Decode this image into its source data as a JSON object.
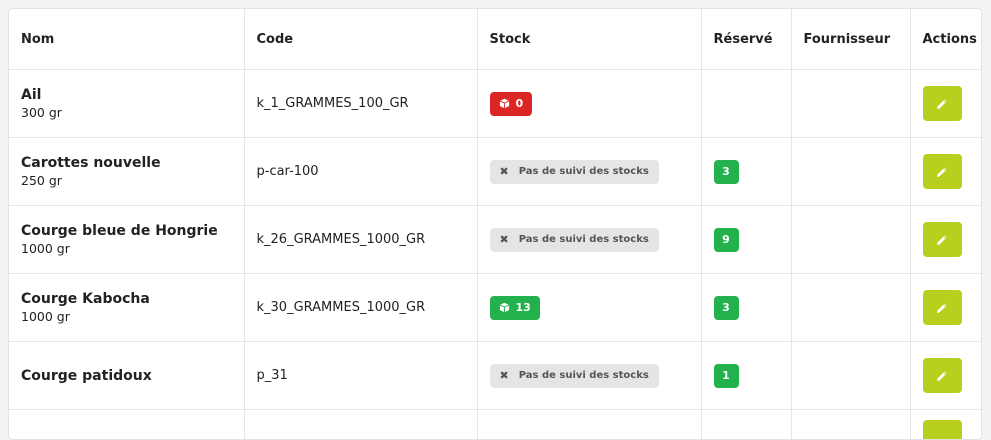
{
  "colors": {
    "danger": "#dc2626",
    "success": "#22b14c",
    "neutral": "#e5e5e5",
    "action": "#b8cf1d"
  },
  "table": {
    "headers": {
      "nom": "Nom",
      "code": "Code",
      "stock": "Stock",
      "reserve": "Réservé",
      "fournisseur": "Fournisseur",
      "actions": "Actions"
    },
    "rows": [
      {
        "name": "Ail",
        "qty": "300 gr",
        "code": "k_1_GRAMMES_100_GR",
        "stock_type": "number",
        "stock_status": "danger",
        "stock": "0",
        "reserve": "",
        "fournisseur": "",
        "stock_icon": "box-icon"
      },
      {
        "name": "Carottes nouvelle",
        "qty": "250 gr",
        "code": "p-car-100",
        "stock_type": "untracked",
        "stock": "Pas de suivi des stocks",
        "reserve": "3",
        "fournisseur": "",
        "stock_icon": "close-icon"
      },
      {
        "name": "Courge bleue de Hongrie",
        "qty": "1000 gr",
        "code": "k_26_GRAMMES_1000_GR",
        "stock_type": "untracked",
        "stock": "Pas de suivi des stocks",
        "reserve": "9",
        "fournisseur": "",
        "stock_icon": "close-icon"
      },
      {
        "name": "Courge Kabocha",
        "qty": "1000 gr",
        "code": "k_30_GRAMMES_1000_GR",
        "stock_type": "number",
        "stock_status": "success",
        "stock": "13",
        "reserve": "3",
        "fournisseur": "",
        "stock_icon": "box-icon"
      },
      {
        "name": "Courge patidoux",
        "qty": "",
        "code": "p_31",
        "stock_type": "untracked",
        "stock": "Pas de suivi des stocks",
        "reserve": "1",
        "fournisseur": "",
        "stock_icon": "close-icon"
      }
    ],
    "action_icon": "pencil-icon"
  }
}
